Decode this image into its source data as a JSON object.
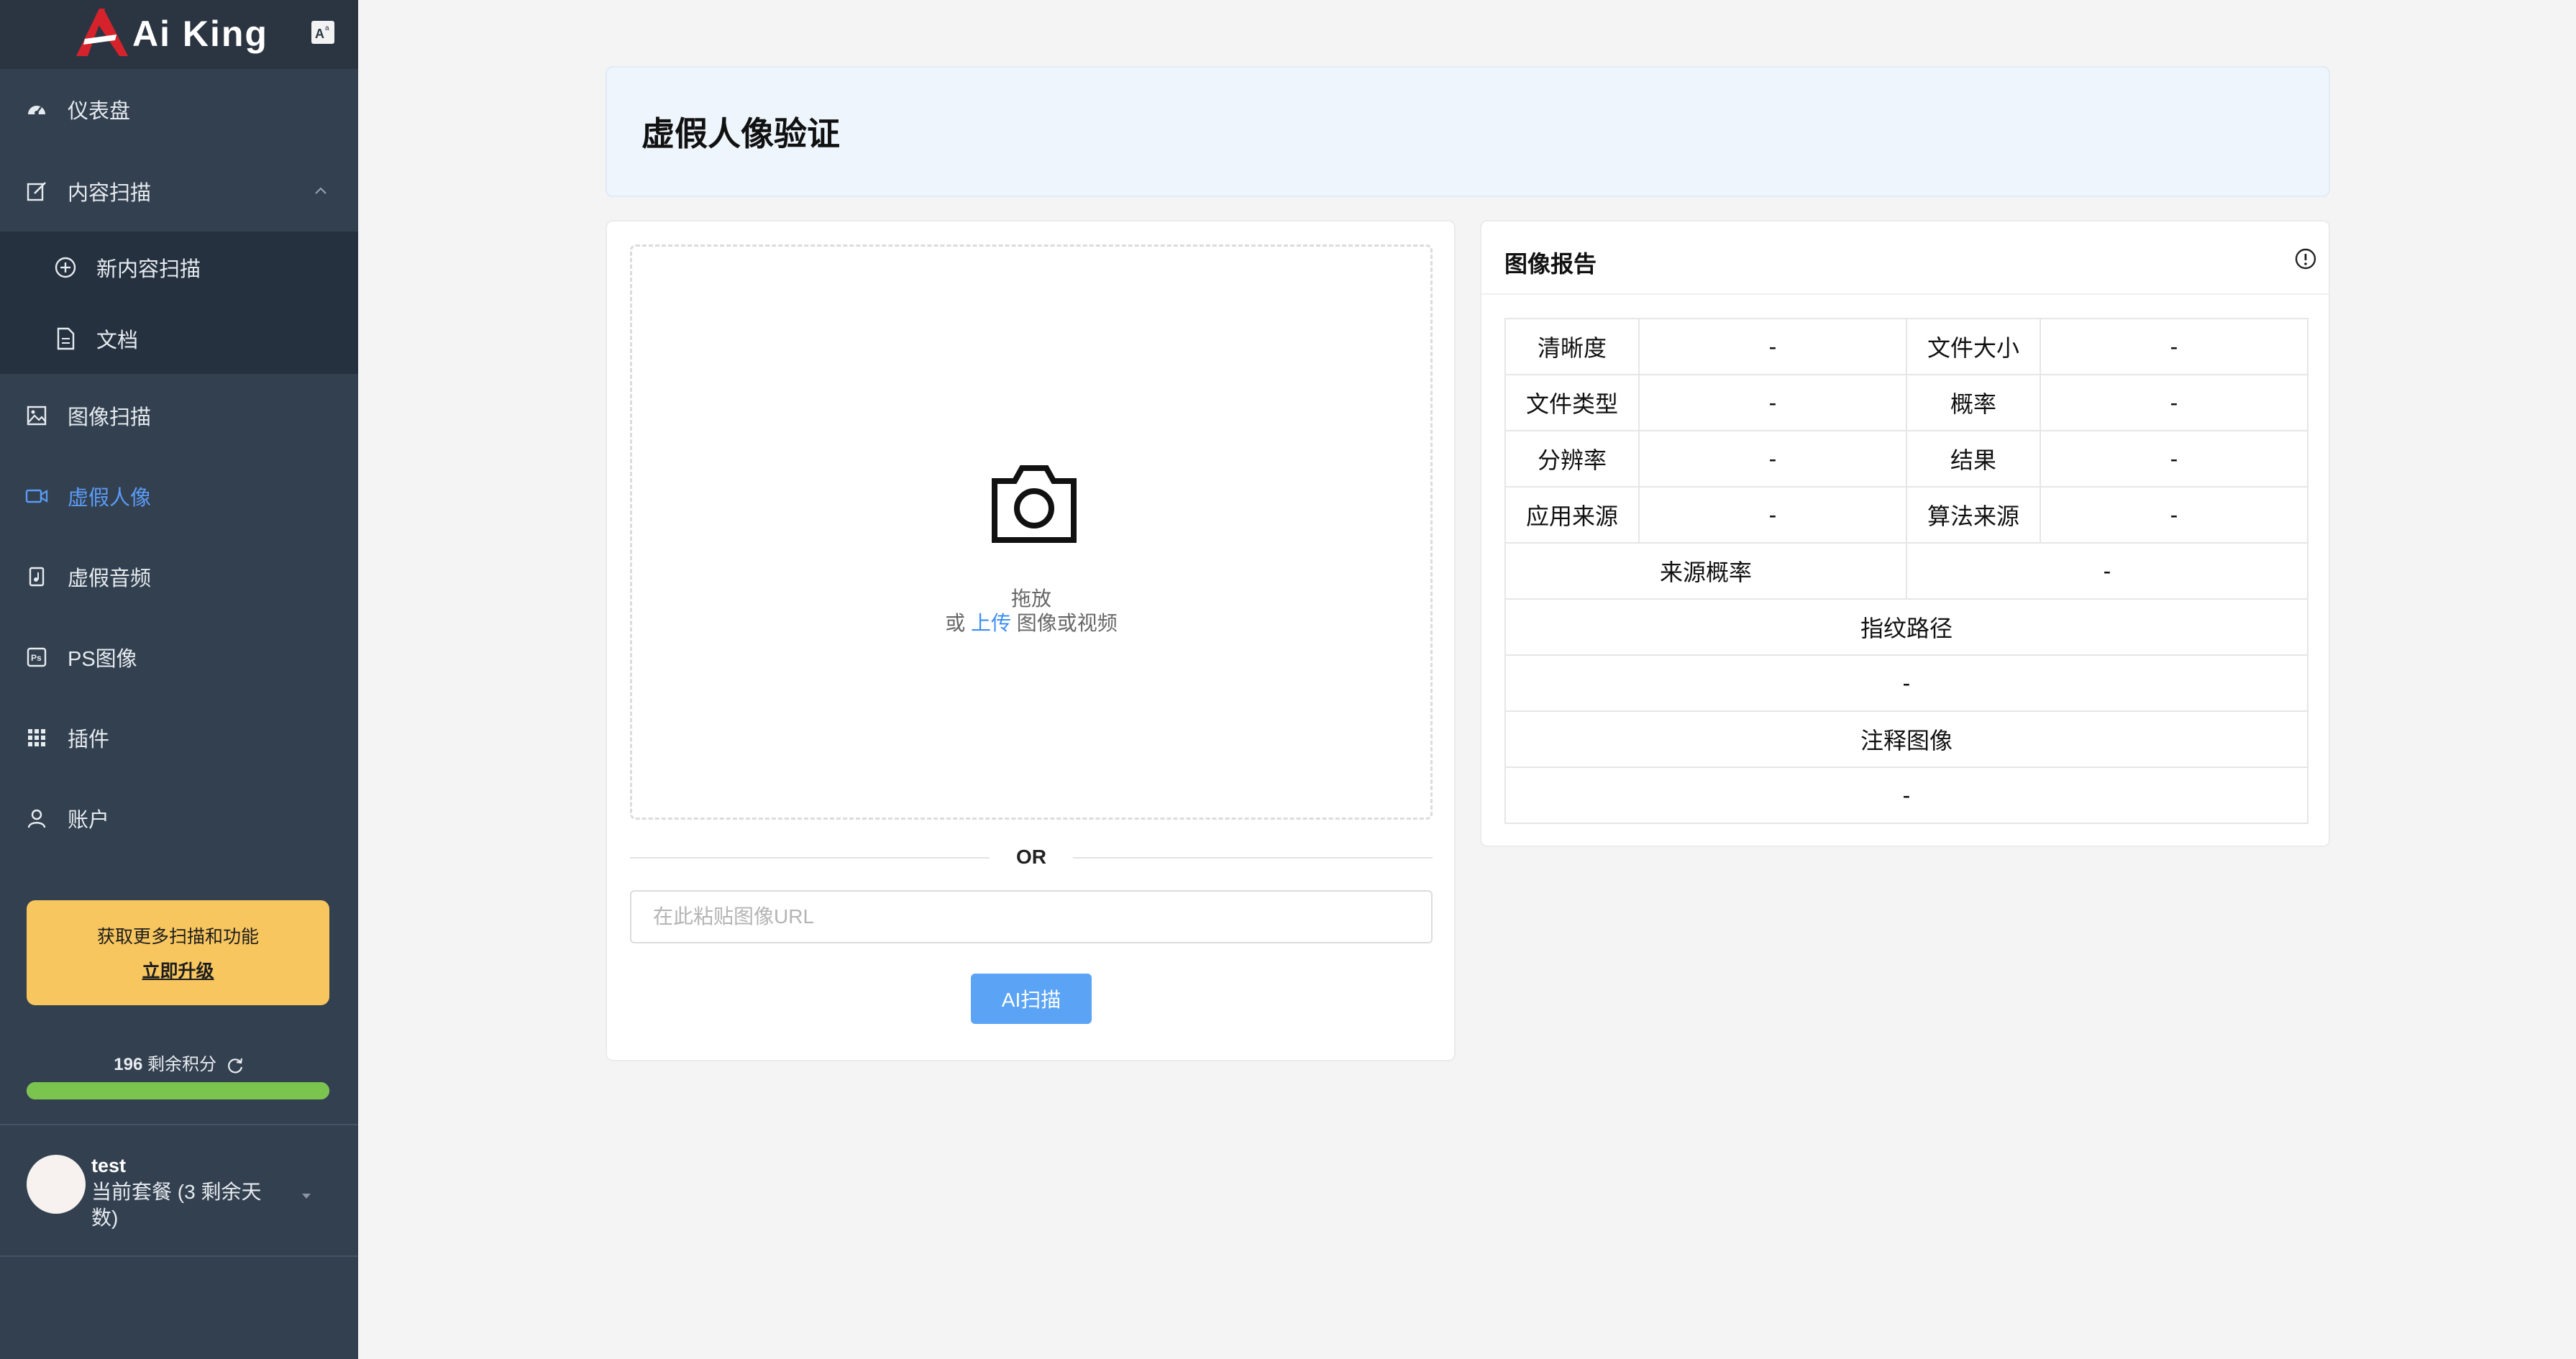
{
  "app": {
    "brand": "Ai King"
  },
  "sidebar": {
    "dashboard": "仪表盘",
    "content_scan": "内容扫描",
    "new_content_scan": "新内容扫描",
    "documents": "文档",
    "image_scan": "图像扫描",
    "fake_portrait": "虚假人像",
    "fake_audio": "虚假音频",
    "ps_image": "PS图像",
    "plugins": "插件",
    "account": "账户",
    "active_item": "虚假人像"
  },
  "upgrade": {
    "text": "获取更多扫描和功能",
    "link": "立即升级"
  },
  "credits": {
    "count": "196",
    "label": "剩余积分",
    "bar_fill_percent": 100
  },
  "user": {
    "name": "test",
    "plan": "当前套餐 (3 剩余天数)"
  },
  "page": {
    "title": "虚假人像验证"
  },
  "upload": {
    "drag_text": "拖放",
    "or_text": "或",
    "upload_link": "上传",
    "upload_suffix": "图像或视频",
    "divider": "OR",
    "url_placeholder": "在此粘贴图像URL",
    "scan_button": "AI扫描"
  },
  "report": {
    "title": "图像报告",
    "rows": [
      {
        "label1": "清晰度",
        "value1": "-",
        "label2": "文件大小",
        "value2": "-"
      },
      {
        "label1": "文件类型",
        "value1": "-",
        "label2": "概率",
        "value2": "-"
      },
      {
        "label1": "分辨率",
        "value1": "-",
        "label2": "结果",
        "value2": "-"
      },
      {
        "label1": "应用来源",
        "value1": "-",
        "label2": "算法来源",
        "value2": "-"
      }
    ],
    "source_probability_label": "来源概率",
    "source_probability_value": "-",
    "fingerprint_path_label": "指纹路径",
    "fingerprint_path_value": "-",
    "annotated_image_label": "注释图像",
    "annotated_image_value": "-"
  },
  "colors": {
    "sidebar_bg": "#33404f",
    "accent": "#5b9bf5",
    "upgrade_bg": "#f8c65f",
    "credit_bar": "#7bc54f",
    "scan_button": "#5aa3f5"
  }
}
